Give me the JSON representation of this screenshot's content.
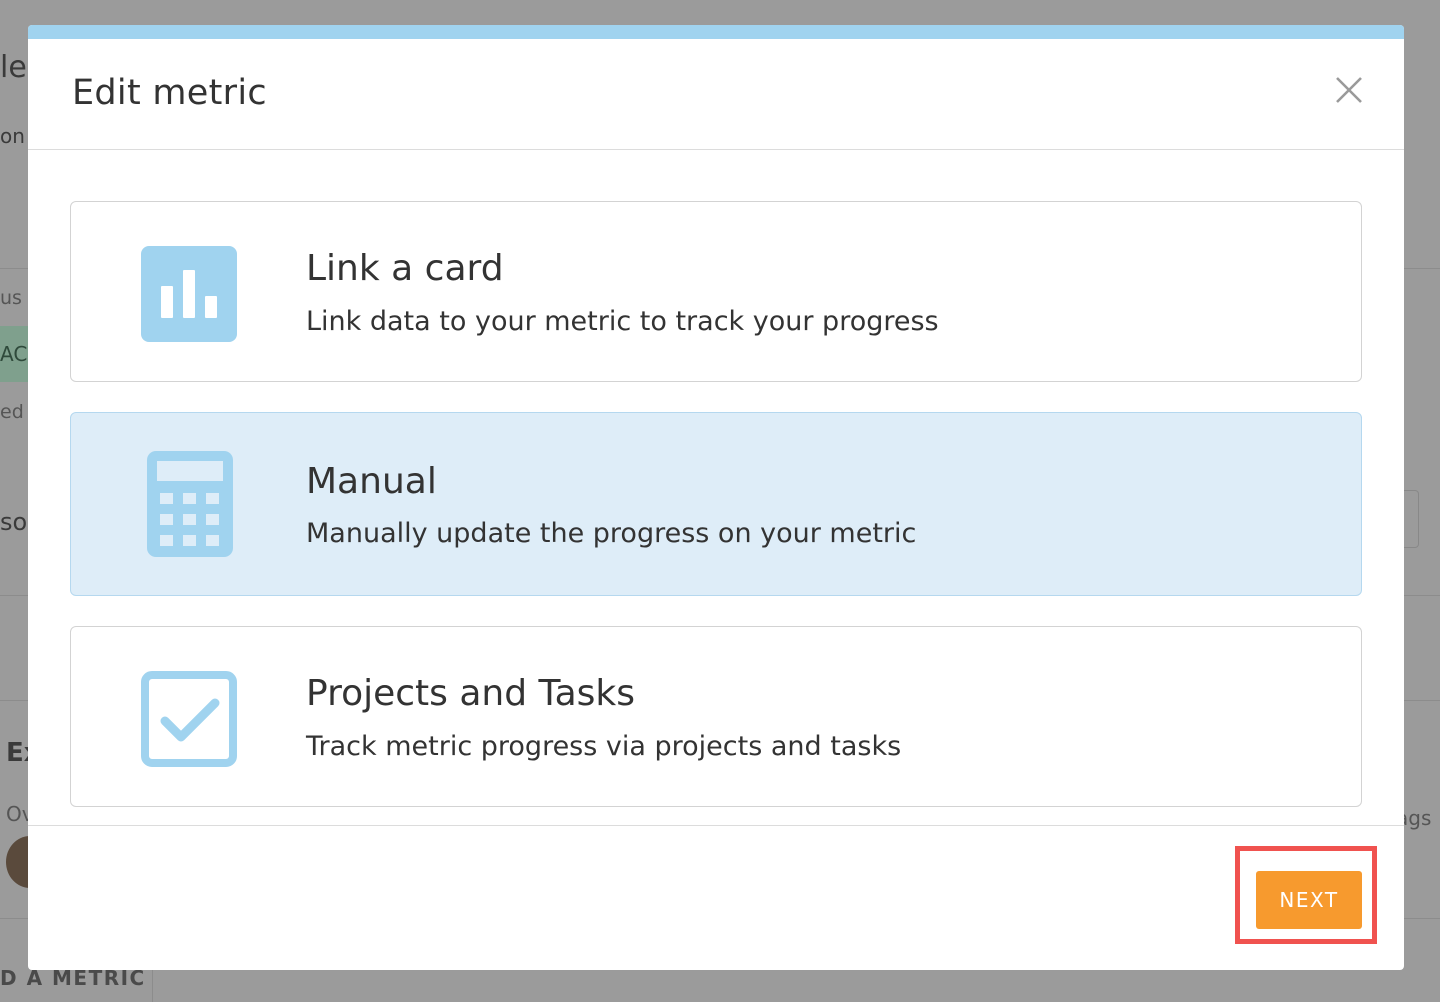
{
  "background": {
    "fragments": [
      "le",
      "on",
      "us",
      "AC",
      "ed",
      "so",
      "Ex",
      "Ov",
      "ags",
      "D A METRIC"
    ]
  },
  "modal": {
    "title": "Edit metric",
    "close_icon": "close-icon",
    "options": [
      {
        "title": "Link a card",
        "description": "Link data to your metric to track your progress",
        "icon": "bar-chart-icon",
        "selected": false
      },
      {
        "title": "Manual",
        "description": "Manually update the progress on your metric",
        "icon": "calculator-icon",
        "selected": true
      },
      {
        "title": "Projects and Tasks",
        "description": "Track metric progress via projects and tasks",
        "icon": "checkbox-icon",
        "selected": false
      }
    ],
    "next_label": "NEXT"
  },
  "colors": {
    "accent_bar": "#a0d3ef",
    "selected_bg": "#deedf8",
    "icon": "#a0d3ef",
    "next_button": "#f79a2e",
    "highlight": "#f0524f"
  }
}
